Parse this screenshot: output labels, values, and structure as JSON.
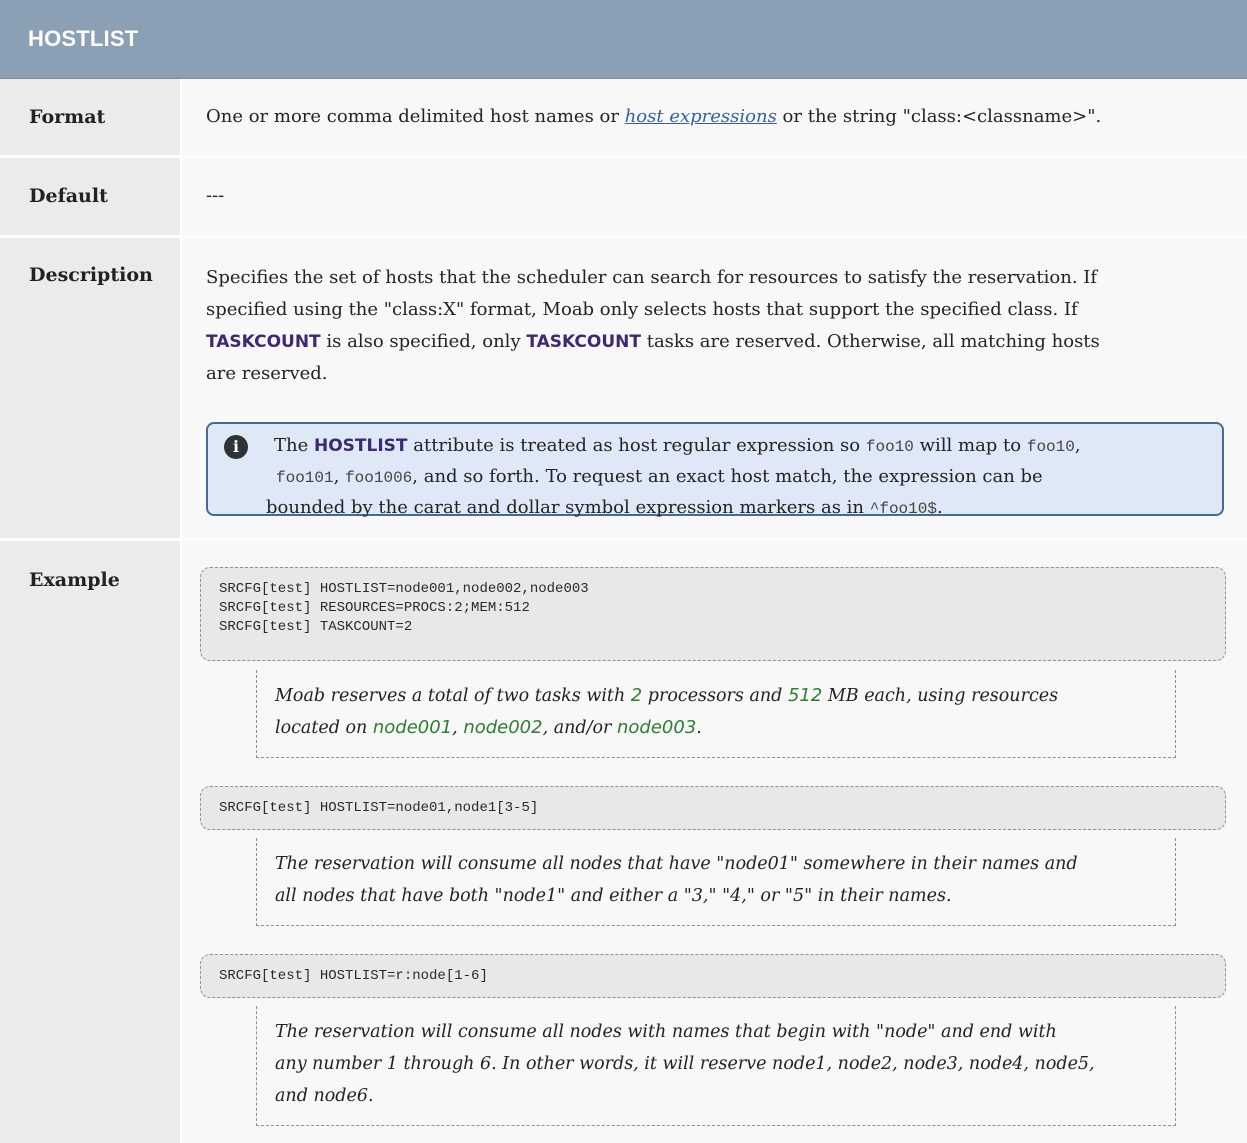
{
  "header": {
    "title": "HOSTLIST"
  },
  "rows": {
    "format": {
      "label": "Format",
      "text_before": "One or more comma delimited host names or ",
      "link": "host expressions",
      "text_after": " or the string \"class:<classname>\"."
    },
    "default": {
      "label": "Default",
      "value": "---"
    },
    "description": {
      "label": "Description",
      "line1": "Specifies the set of hosts that the scheduler can search for resources to satisfy the reservation. If",
      "line2": "specified using the \"class:X\" format, Moab only selects hosts that support the specified class. If",
      "line3_kw1": "TASKCOUNT",
      "line3_mid": " is also specified, only ",
      "line3_kw2": "TASKCOUNT",
      "line3_end": " tasks are reserved. Otherwise, all matching hosts",
      "line4": "are reserved.",
      "note": {
        "p1": "The ",
        "kw": "HOSTLIST",
        "p2": " attribute is treated as host regular expression so ",
        "code1": "foo10",
        "p3": " will map to ",
        "code2": "foo10",
        "p4": ",",
        "code3": "foo101",
        "p5": ", ",
        "code4": "foo1006",
        "p6": ", and so forth. To request an exact host match, the expression can be",
        "p7": "bounded by the carat and dollar symbol expression markers as in ",
        "code5": "^foo10$",
        "p8": "."
      }
    },
    "example": {
      "label": "Example",
      "code1": "SRCFG[test] HOSTLIST=node001,node002,node003\nSRCFG[test] RESOURCES=PROCS:2;MEM:512\nSRCFG[test] TASKCOUNT=2",
      "explain1": {
        "a": "Moab reserves a total of two tasks with ",
        "g1": "2",
        "b": " processors and ",
        "g2": "512",
        "c": " MB each, using resources",
        "d": "located on ",
        "g3": "node001",
        "e": ", ",
        "g4": "node002",
        "f": ", and/or ",
        "g5": "node003",
        "h": "."
      },
      "code2": "SRCFG[test] HOSTLIST=node01,node1[3-5]",
      "explain2": {
        "line1": "The reservation will consume all nodes that have \"node01\" somewhere in their names and",
        "line2": "all nodes that have both \"node1\" and either a \"3,\" \"4,\" or \"5\" in their names."
      },
      "code3": "SRCFG[test] HOSTLIST=r:node[1-6]",
      "explain3": {
        "line1": "The reservation will consume all nodes with names that begin with \"node\" and end with",
        "line2": "any number 1 through 6. In other words, it will reserve node1, node2, node3, node4, node5,",
        "line3": "and node6."
      }
    }
  }
}
